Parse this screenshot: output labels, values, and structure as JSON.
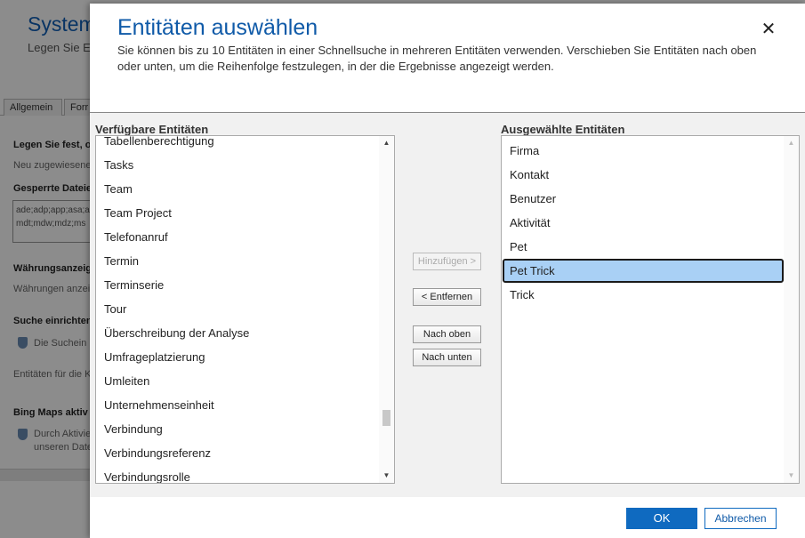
{
  "background": {
    "title": "System",
    "subtitle": "Legen Sie Ei",
    "tabs": [
      "Allgemein",
      "Forr"
    ],
    "lines": [
      "Legen Sie fest, o",
      "Neu zugewiesene",
      "Gesperrte Dateie",
      "Währungsanzeig",
      "Währungen anzei",
      "Suche einrichten",
      "Die Suchein",
      "Entitäten für die K",
      "Bing Maps aktiv",
      "Durch Aktivie",
      "unseren Date"
    ],
    "blocked_ext": "ade;adp;app;asa;a mdt;mdw;mdz;ms"
  },
  "dialog": {
    "title": "Entitäten auswählen",
    "close_label": "✕",
    "description": "Sie können bis zu 10 Entitäten in einer Schnellsuche in mehreren Entitäten verwenden. Verschieben Sie Entitäten nach oben oder unten, um die Reihenfolge festzulegen, in der die Ergebnisse angezeigt werden.",
    "available": {
      "label": "Verfügbare Entitäten",
      "items": [
        "Tabellenberechtigung",
        "Tasks",
        "Team",
        "Team Project",
        "Telefonanruf",
        "Termin",
        "Terminserie",
        "Tour",
        "Überschreibung der Analyse",
        "Umfrageplatzierung",
        "Umleiten",
        "Unternehmenseinheit",
        "Verbindung",
        "Verbindungsreferenz",
        "Verbindungsrolle"
      ]
    },
    "selected": {
      "label": "Ausgewählte Entitäten",
      "items": [
        "Firma",
        "Kontakt",
        "Benutzer",
        "Aktivität",
        "Pet",
        "Pet Trick",
        "Trick"
      ],
      "selected_index": 5
    },
    "buttons": {
      "add": "Hinzufügen >",
      "remove": "< Entfernen",
      "up": "Nach oben",
      "down": "Nach unten"
    },
    "footer": {
      "ok": "OK",
      "cancel": "Abbrechen"
    }
  },
  "colors": {
    "accent": "#0f6ac0",
    "title": "#0f5aa8",
    "selection": "#a9d0f5"
  }
}
